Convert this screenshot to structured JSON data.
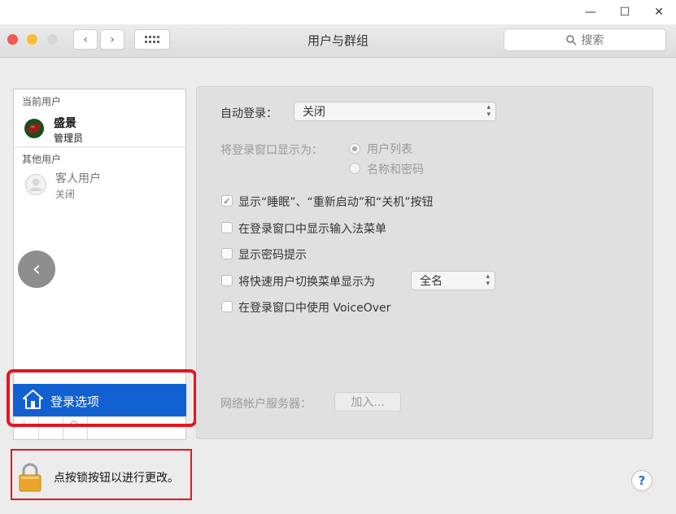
{
  "host_window": {
    "minimize_glyph": "—",
    "maximize_glyph": "☐",
    "close_glyph": "✕"
  },
  "toolbar": {
    "back_glyph": "‹",
    "forward_glyph": "›",
    "title": "用户与群组",
    "search_placeholder": "搜索",
    "traffic_colors": {
      "close": "#ec5b55",
      "minimize": "#f6be36",
      "zoom": "#d7d7d7"
    }
  },
  "sidebar": {
    "current_users_title": "当前用户",
    "current_user": {
      "name": "盛景",
      "role": "管理员"
    },
    "other_users_title": "其他用户",
    "guest_user": {
      "name": "客人用户",
      "status": "关闭"
    },
    "back_glyph": "‹",
    "selected_item": {
      "label": "登录选项",
      "icon": "house-icon",
      "color": "#1160d2"
    },
    "bottom_buttons": [
      "+",
      "−",
      "⚙"
    ]
  },
  "login_options": {
    "auto_login_label": "自动登录：",
    "auto_login_value": "关闭",
    "display_window_label": "将登录窗口显示为：",
    "radio_options": [
      {
        "label": "用户列表",
        "selected": true
      },
      {
        "label": "名称和密码",
        "selected": false
      }
    ],
    "checkboxes": [
      {
        "label": "显示“睡眠”、“重新启动”和“关机”按钮",
        "checked": true
      },
      {
        "label": "在登录窗口中显示输入法菜单",
        "checked": false
      },
      {
        "label": "显示密码提示",
        "checked": false
      },
      {
        "label": "将快速用户切换菜单显示为",
        "checked": false
      },
      {
        "label": "在登录窗口中使用 VoiceOver",
        "checked": false
      }
    ],
    "fast_user_switch_value": "全名",
    "network_server_label": "网络帐户服务器：",
    "join_button": "加入..."
  },
  "footer": {
    "lock_text": "点按锁按钮以进行更改。",
    "help_glyph": "?"
  },
  "highlight_color": "#e8141e"
}
